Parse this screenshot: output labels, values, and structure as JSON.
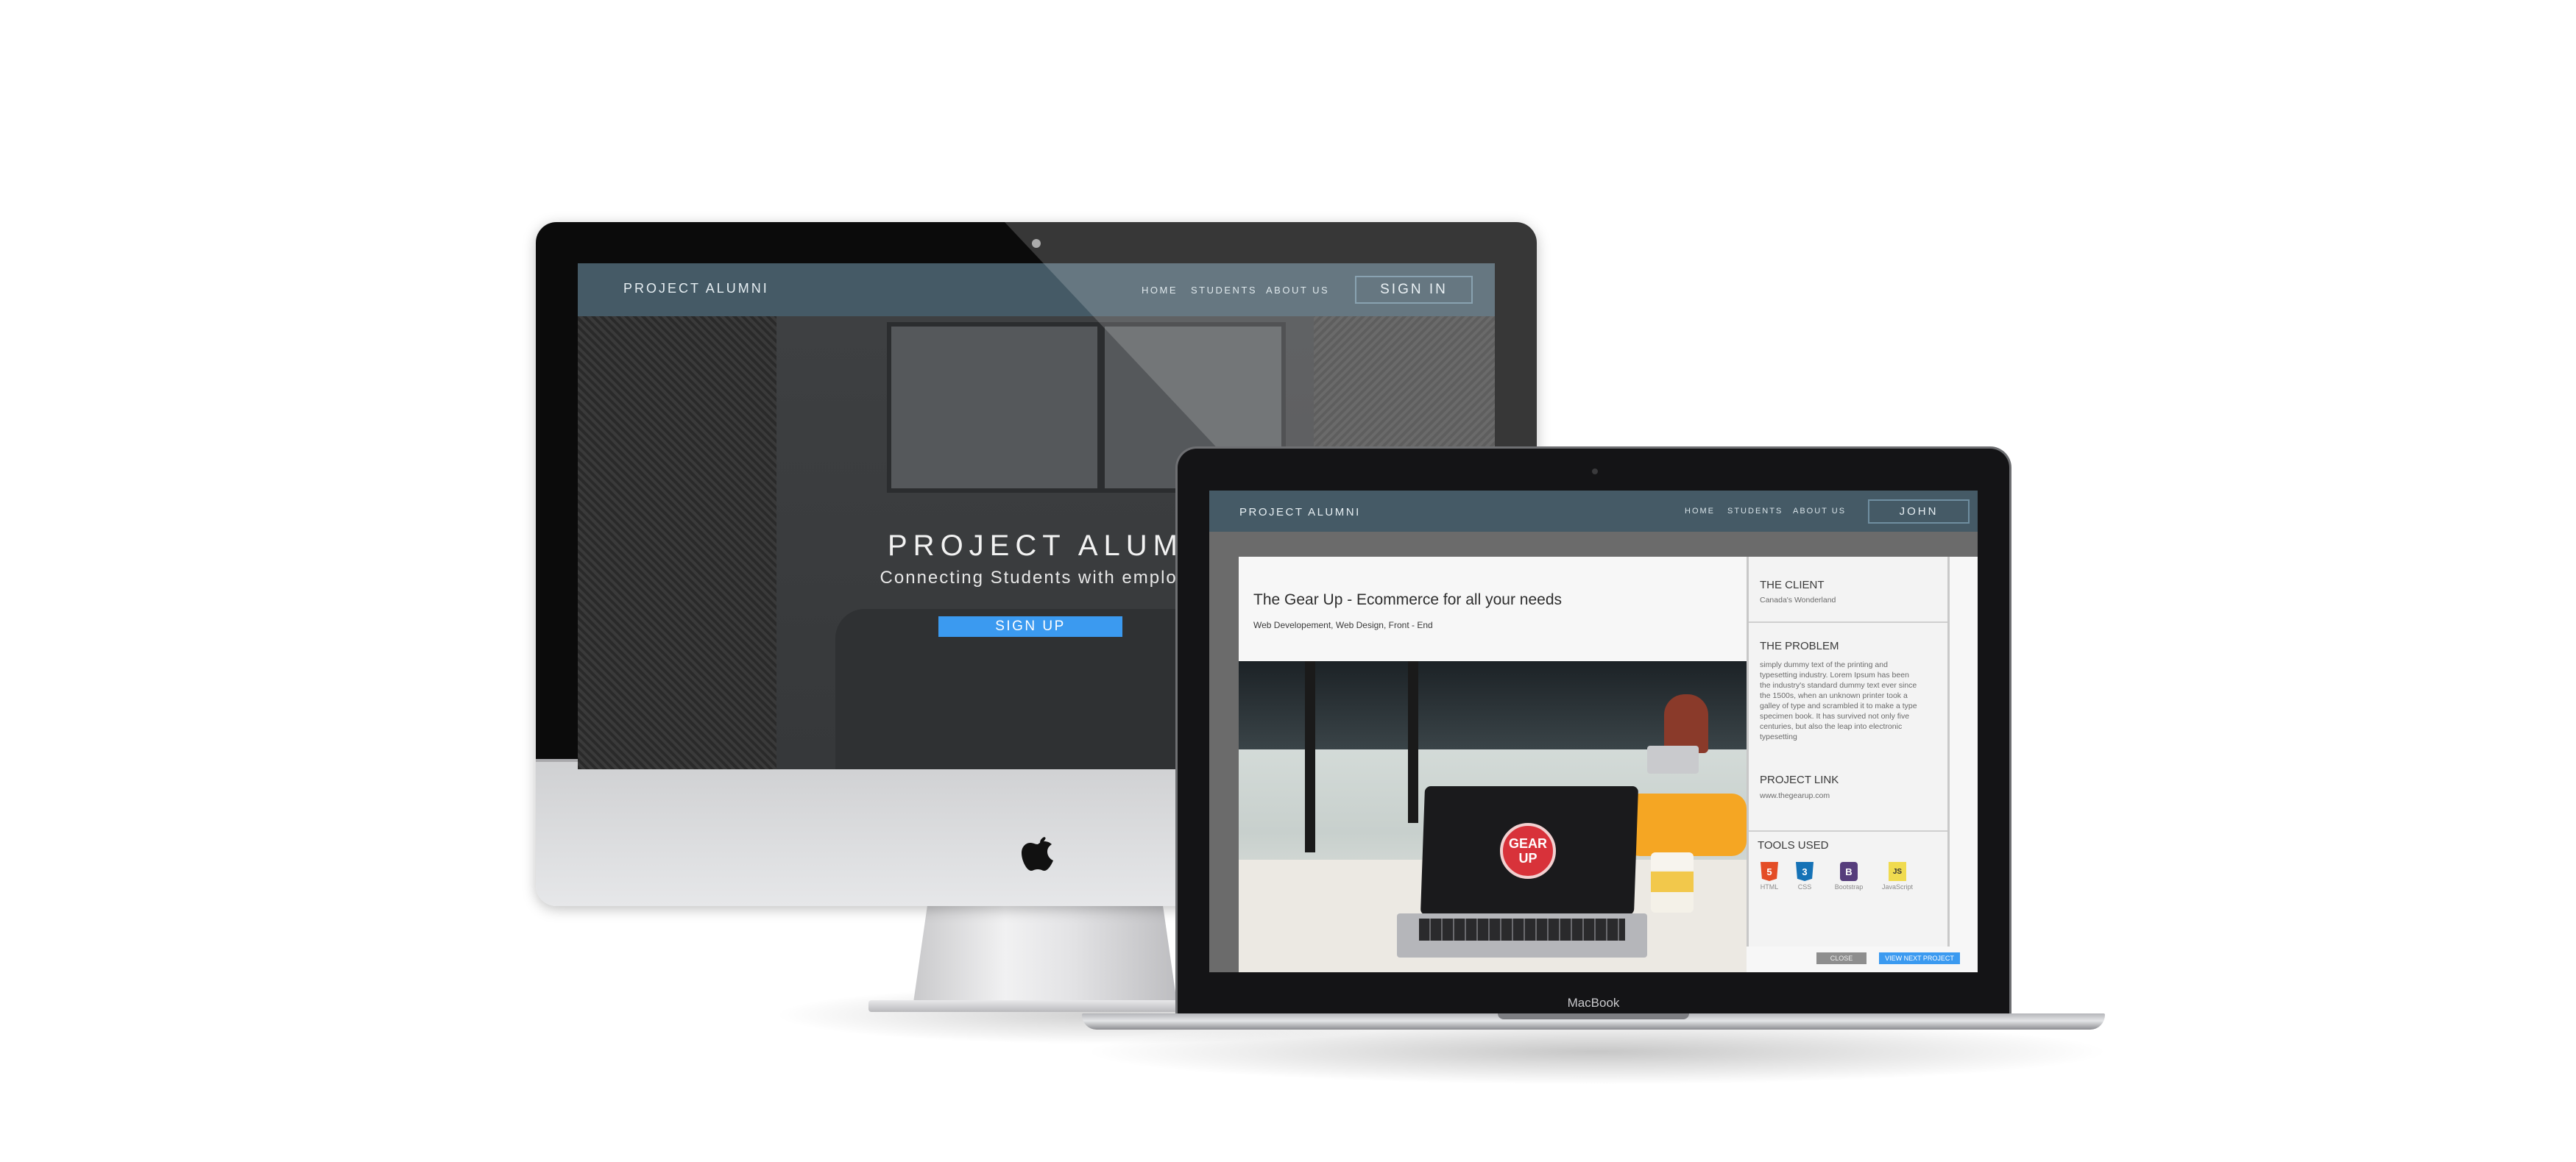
{
  "imac": {
    "nav": {
      "brand": "PROJECT ALUMNI",
      "links": [
        "HOME",
        "STUDENTS",
        "ABOUT US"
      ],
      "sign_in": "SIGN IN"
    },
    "hero": {
      "title": "PROJECT ALUMNI",
      "subtitle": "Connecting Students with employee",
      "cta": "SIGN UP"
    }
  },
  "macbook": {
    "label": "MacBook",
    "nav": {
      "brand": "PROJECT ALUMNI",
      "links": [
        "HOME",
        "STUDENTS",
        "ABOUT US"
      ],
      "user": "JOHN"
    },
    "modal": {
      "title": "The Gear Up - Ecommerce for all your needs",
      "tags": "Web Developement, Web Design, Front - End",
      "photo_logo": "GEAR UP",
      "client_heading": "THE CLIENT",
      "client_value": "Canada's Wonderland",
      "problem_heading": "THE PROBLEM",
      "problem_text": "simply dummy text of the printing and typesetting industry. Lorem Ipsum has been the industry's standard dummy text ever since the 1500s, when an unknown printer took a galley of type and scrambled it to make a type specimen book. It has survived not only five centuries, but also the leap into electronic typesetting",
      "link_heading": "PROJECT LINK",
      "link_value": "www.thegearup.com",
      "tools_heading": "TOOLS USED",
      "tools": [
        {
          "label": "HTML",
          "badge": "5",
          "color": "#e44d26"
        },
        {
          "label": "CSS",
          "badge": "3",
          "color": "#1572b6"
        },
        {
          "label": "Bootstrap",
          "badge": "B",
          "color": "#563d7c"
        },
        {
          "label": "JavaScript",
          "badge": "JS",
          "color": "#f0db4f"
        }
      ],
      "close_label": "CLOSE",
      "next_label": "VIEW NEXT PROJECT"
    }
  }
}
